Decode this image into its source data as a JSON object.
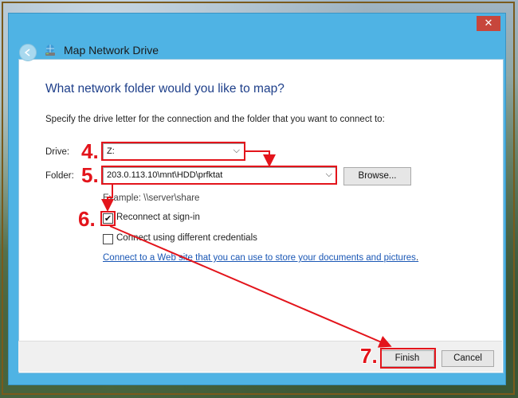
{
  "window": {
    "title": "Map Network Drive",
    "close_glyph": "✕",
    "accent_color": "#4fb3e4"
  },
  "main": {
    "heading": "What network folder would you like to map?",
    "description": "Specify the drive letter for the connection and the folder that you want to connect to:",
    "drive_label": "Drive:",
    "drive_value": "Z:",
    "folder_label": "Folder:",
    "folder_value": "203.0.113.10\\mnt\\HDD\\prfktat",
    "browse_label": "Browse...",
    "example_text": "Example: \\\\server\\share",
    "reconnect_label": "Reconnect at sign-in",
    "reconnect_checked": true,
    "credentials_label": "Connect using different credentials",
    "credentials_checked": false,
    "link_text": "Connect to a Web site that you can use to store your documents and pictures",
    "link_suffix": "."
  },
  "footer": {
    "finish_label": "Finish",
    "cancel_label": "Cancel"
  },
  "annotations": {
    "step4": "4.",
    "step5": "5.",
    "step6": "6.",
    "step7": "7.",
    "color": "#e3141b"
  },
  "icons": [
    "back-arrow-icon",
    "network-drive-icon",
    "close-icon",
    "chevron-down-icon",
    "checkmark-icon"
  ]
}
